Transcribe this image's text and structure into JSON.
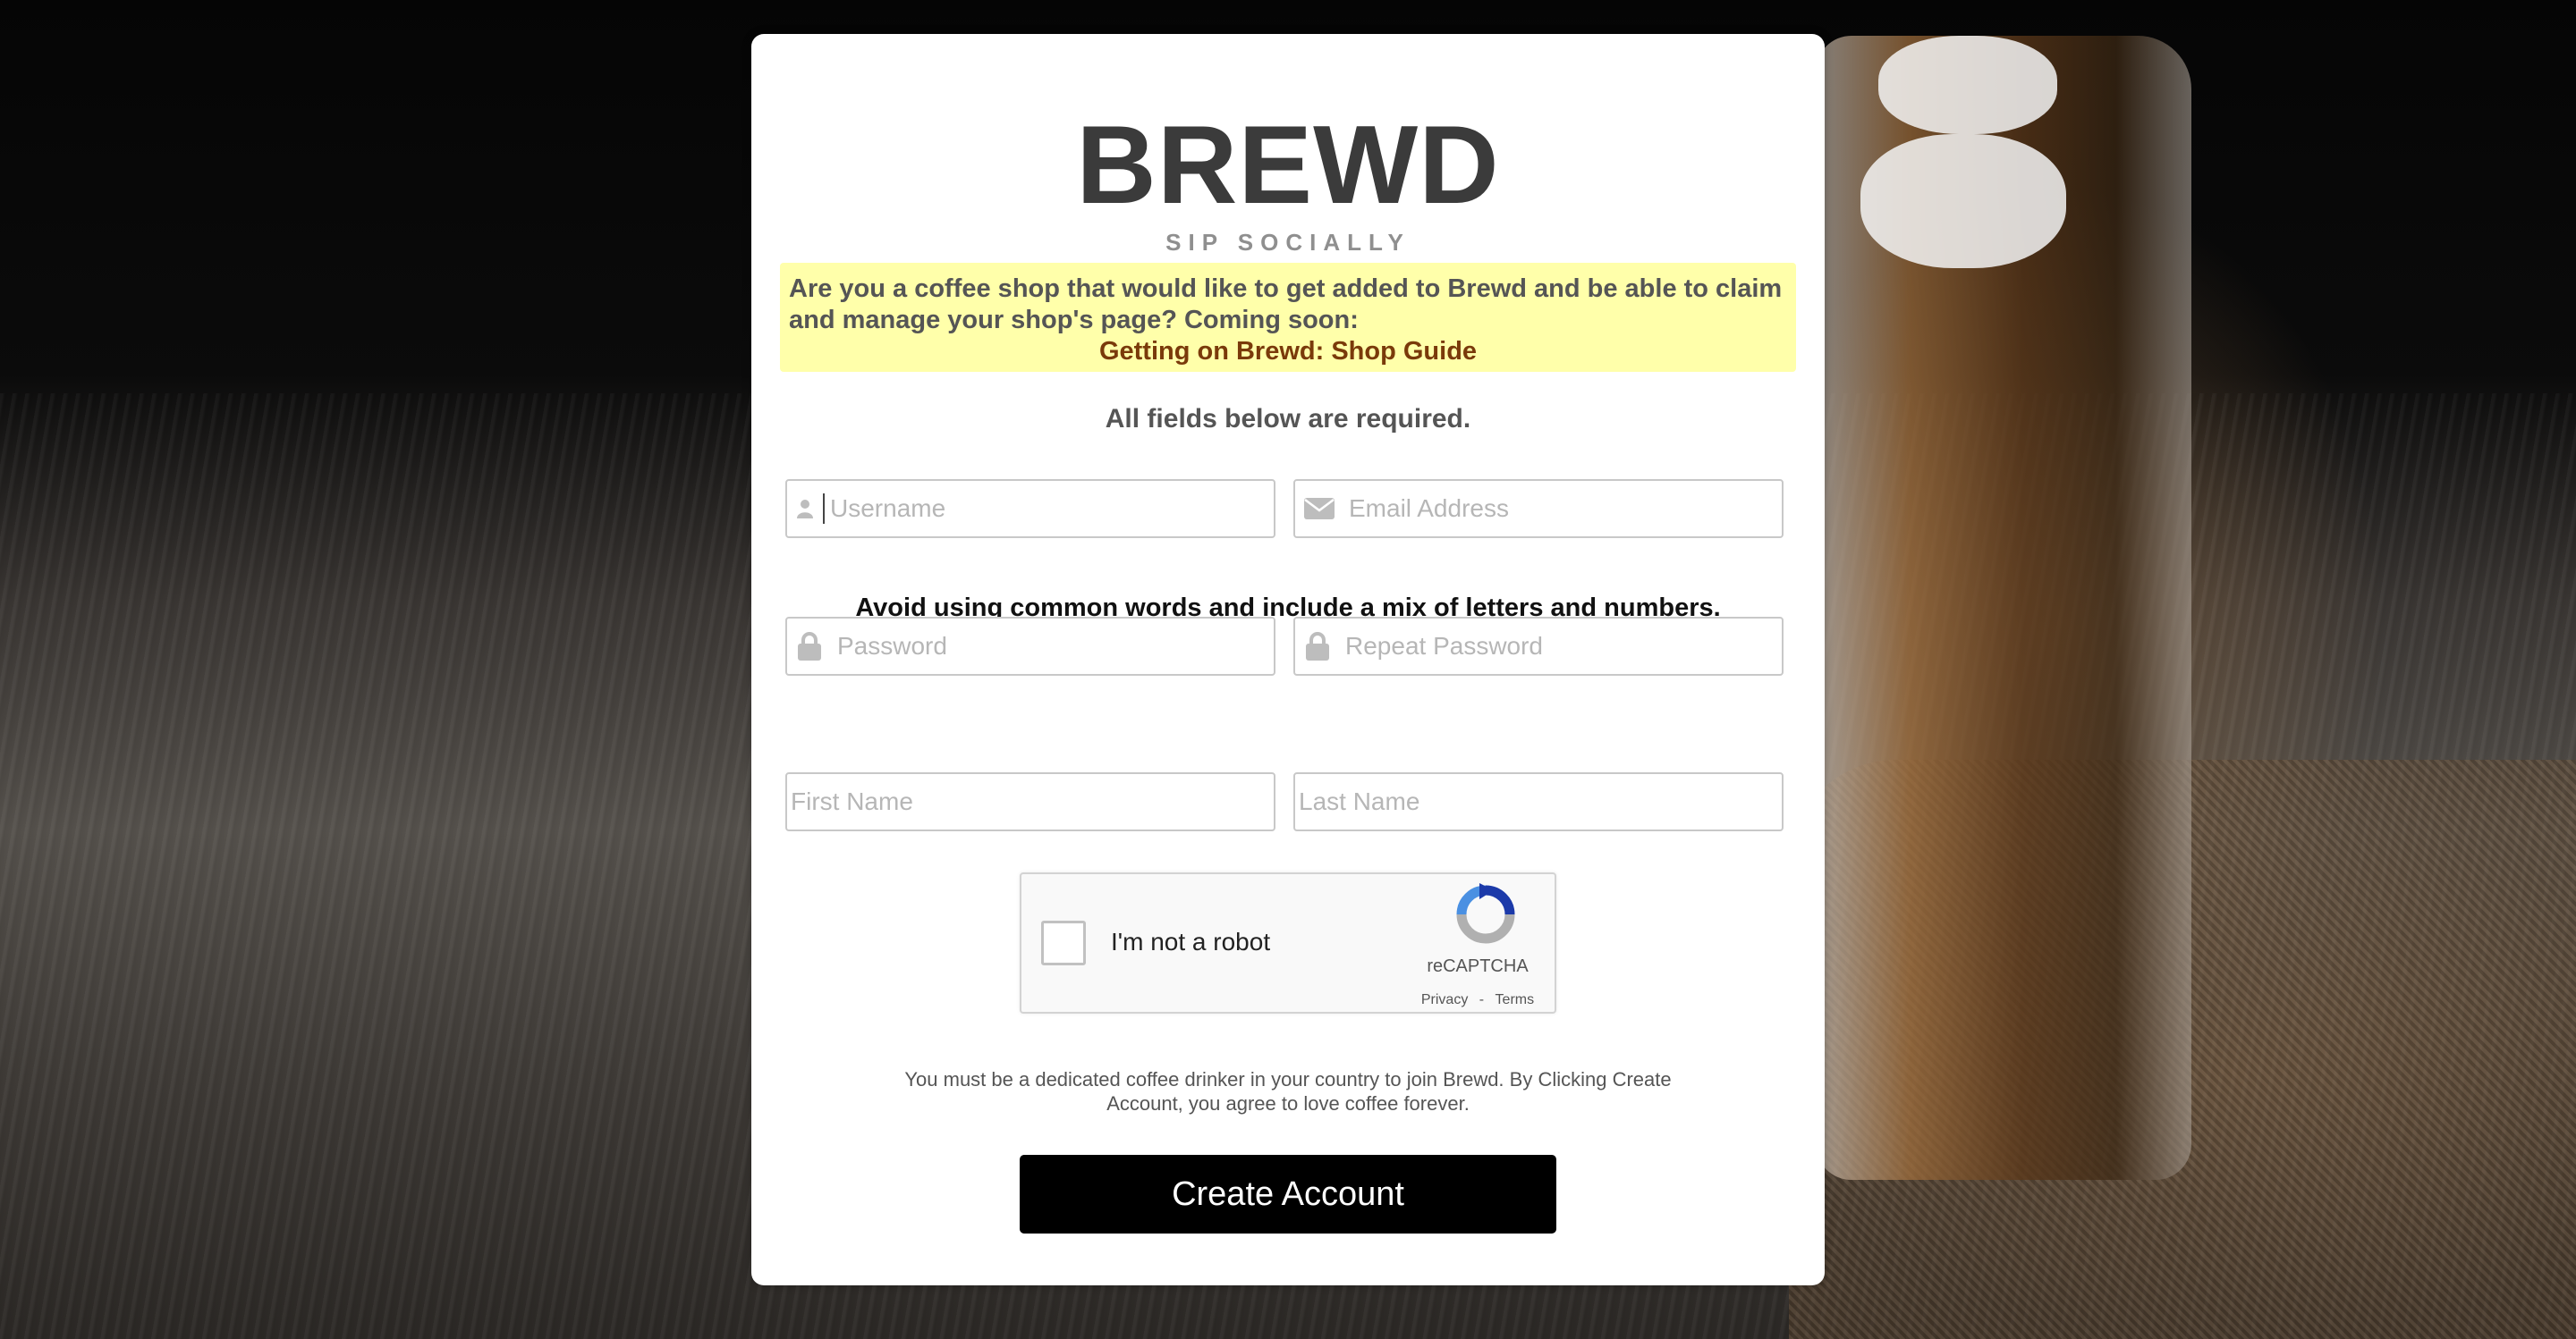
{
  "brand": {
    "logo": "BREWD",
    "tagline": "SIP SOCIALLY"
  },
  "notice": {
    "text": "Are you a coffee shop that would like to get added to Brewd and be able to claim and manage your shop's page? Coming soon:",
    "link_label": "Getting on Brewd: Shop Guide"
  },
  "form": {
    "required_note": "All fields below are required.",
    "username": {
      "placeholder": "Username",
      "value": "",
      "icon": "user-icon"
    },
    "email": {
      "placeholder": "Email Address",
      "value": "",
      "icon": "envelope-icon"
    },
    "password_hint": "Avoid using common words and include a mix of letters and numbers.",
    "password": {
      "placeholder": "Password",
      "value": "",
      "icon": "lock-icon"
    },
    "repeat_password": {
      "placeholder": "Repeat Password",
      "value": "",
      "icon": "lock-icon"
    },
    "first_name": {
      "placeholder": "First Name",
      "value": ""
    },
    "last_name": {
      "placeholder": "Last Name",
      "value": ""
    }
  },
  "captcha": {
    "label": "I'm not a robot",
    "brand": "reCAPTCHA",
    "privacy": "Privacy",
    "terms": "Terms",
    "separator": " - "
  },
  "legal_text": "You must be a dedicated coffee drinker in your country to join Brewd. By Clicking Create Account, you agree to love coffee forever.",
  "submit_label": "Create Account",
  "colors": {
    "notice_bg": "#ffffaa",
    "notice_link": "#7a3a0a",
    "button_bg": "#000000",
    "logo": "#3b3b3b"
  }
}
